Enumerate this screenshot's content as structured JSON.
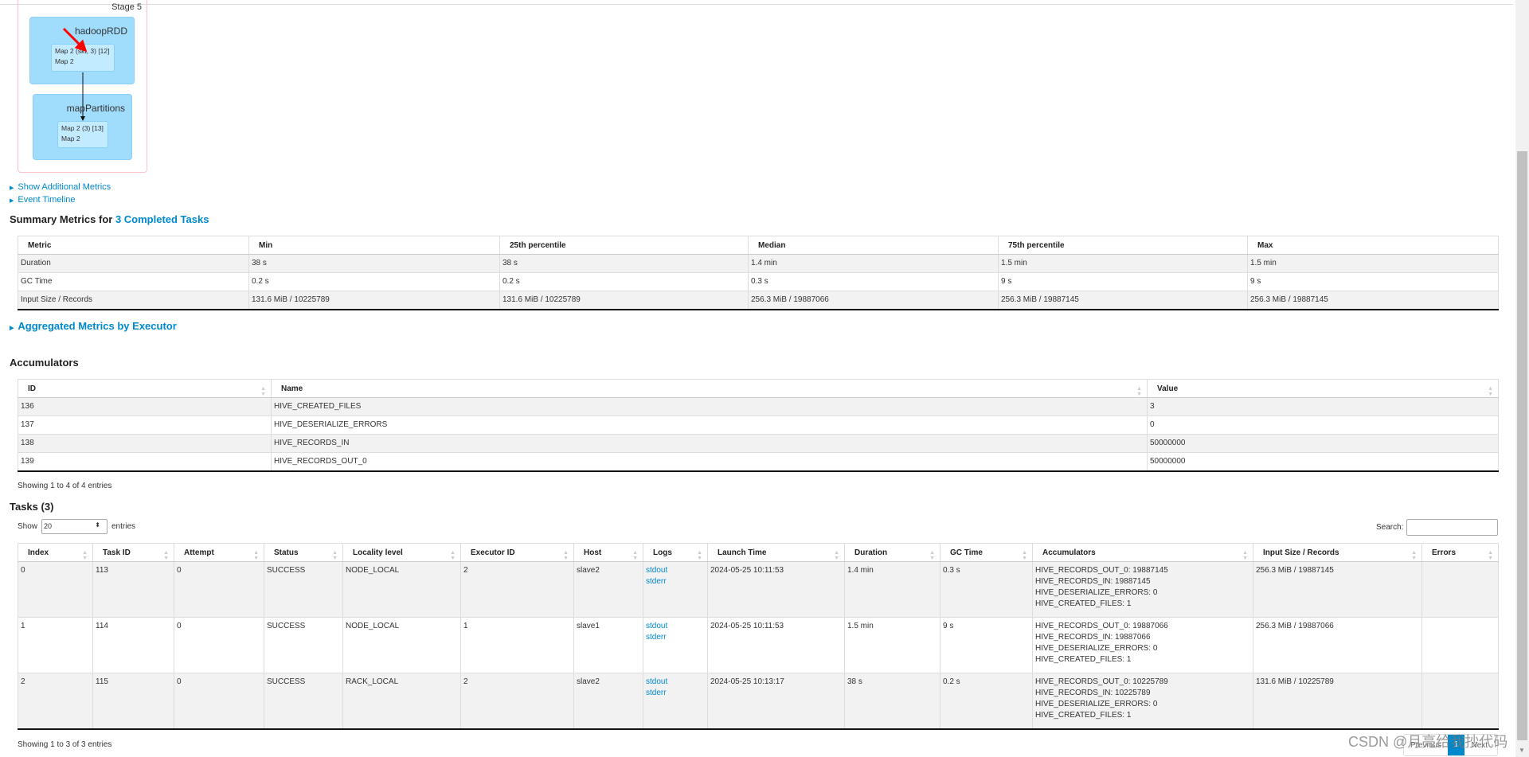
{
  "dag": {
    "stage": "Stage 5",
    "clusters": [
      {
        "label": "hadoopRDD",
        "node_line1": "Map 2 (skt, 3) [12]",
        "node_line2": "Map 2"
      },
      {
        "label": "mapPartitions",
        "node_line1": "Map 2 (3) [13]",
        "node_line2": "Map 2"
      }
    ],
    "annotation_color": "#ff0000"
  },
  "links": {
    "additional_metrics": "Show Additional Metrics",
    "event_timeline": "Event Timeline",
    "aggregated": "Aggregated Metrics by Executor"
  },
  "summary": {
    "title_prefix": "Summary Metrics for ",
    "title_link": "3 Completed Tasks",
    "columns": [
      "Metric",
      "Min",
      "25th percentile",
      "Median",
      "75th percentile",
      "Max"
    ],
    "rows": [
      [
        "Duration",
        "38 s",
        "38 s",
        "1.4 min",
        "1.5 min",
        "1.5 min"
      ],
      [
        "GC Time",
        "0.2 s",
        "0.2 s",
        "0.3 s",
        "9 s",
        "9 s"
      ],
      [
        "Input Size / Records",
        "131.6 MiB / 10225789",
        "131.6 MiB / 10225789",
        "256.3 MiB / 19887066",
        "256.3 MiB / 19887145",
        "256.3 MiB / 19887145"
      ]
    ]
  },
  "accumulators": {
    "title": "Accumulators",
    "columns": [
      "ID",
      "Name",
      "Value"
    ],
    "rows": [
      [
        "136",
        "HIVE_CREATED_FILES",
        "3"
      ],
      [
        "137",
        "HIVE_DESERIALIZE_ERRORS",
        "0"
      ],
      [
        "138",
        "HIVE_RECORDS_IN",
        "50000000"
      ],
      [
        "139",
        "HIVE_RECORDS_OUT_0",
        "50000000"
      ]
    ],
    "info": "Showing 1 to 4 of 4 entries"
  },
  "tasks": {
    "title": "Tasks (3)",
    "show_label": "Show",
    "page_size": "20",
    "entries_label": "entries",
    "search_label": "Search:",
    "search_value": "",
    "columns": [
      "Index",
      "Task ID",
      "Attempt",
      "Status",
      "Locality level",
      "Executor ID",
      "Host",
      "Logs",
      "Launch Time",
      "Duration",
      "GC Time",
      "Accumulators",
      "Input Size / Records",
      "Errors"
    ],
    "rows": [
      {
        "index": "0",
        "task_id": "113",
        "attempt": "0",
        "status": "SUCCESS",
        "locality": "NODE_LOCAL",
        "executor": "2",
        "host": "slave2",
        "logs": [
          "stdout",
          "stderr"
        ],
        "launch": "2024-05-25 10:11:53",
        "duration": "1.4 min",
        "gc": "0.3 s",
        "acc": [
          "HIVE_RECORDS_OUT_0: 19887145",
          "HIVE_RECORDS_IN: 19887145",
          "HIVE_DESERIALIZE_ERRORS: 0",
          "HIVE_CREATED_FILES: 1"
        ],
        "input": "256.3 MiB / 19887145",
        "errors": ""
      },
      {
        "index": "1",
        "task_id": "114",
        "attempt": "0",
        "status": "SUCCESS",
        "locality": "NODE_LOCAL",
        "executor": "1",
        "host": "slave1",
        "logs": [
          "stdout",
          "stderr"
        ],
        "launch": "2024-05-25 10:11:53",
        "duration": "1.5 min",
        "gc": "9 s",
        "acc": [
          "HIVE_RECORDS_OUT_0: 19887066",
          "HIVE_RECORDS_IN: 19887066",
          "HIVE_DESERIALIZE_ERRORS: 0",
          "HIVE_CREATED_FILES: 1"
        ],
        "input": "256.3 MiB / 19887066",
        "errors": ""
      },
      {
        "index": "2",
        "task_id": "115",
        "attempt": "0",
        "status": "SUCCESS",
        "locality": "RACK_LOCAL",
        "executor": "2",
        "host": "slave2",
        "logs": [
          "stdout",
          "stderr"
        ],
        "launch": "2024-05-25 10:13:17",
        "duration": "38 s",
        "gc": "0.2 s",
        "acc": [
          "HIVE_RECORDS_OUT_0: 10225789",
          "HIVE_RECORDS_IN: 10225789",
          "HIVE_DESERIALIZE_ERRORS: 0",
          "HIVE_CREATED_FILES: 1"
        ],
        "input": "131.6 MiB / 10225789",
        "errors": ""
      }
    ],
    "info": "Showing 1 to 3 of 3 entries",
    "pager": {
      "previous": "Previous",
      "current": "1",
      "next": "Next"
    }
  },
  "watermark": "CSDN @月亮给我抄代码",
  "colors": {
    "link": "#0088cc",
    "cluster": "#a0dcfc",
    "node": "#c3ebff",
    "stage_border": "#ffc0cb"
  }
}
